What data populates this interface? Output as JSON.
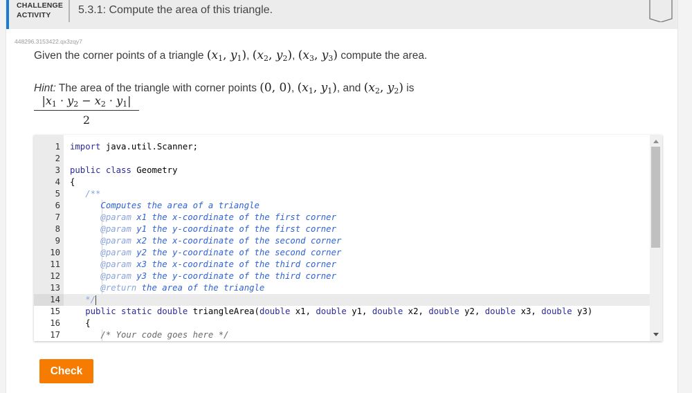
{
  "header": {
    "kind_line1": "CHALLENGE",
    "kind_line2": "ACTIVITY",
    "title": "5.3.1: Compute the area of this triangle.",
    "accent_color": "#1b7cd1",
    "bookmark_icon": "bookmark-icon"
  },
  "activity_id": "448296.3153422.qx3zqy7",
  "prompt": {
    "prefix": "Given the corner points of a triangle ",
    "points": [
      "(x1, y1)",
      "(x2, y2)",
      "(x3, y3)"
    ],
    "suffix": " compute the area."
  },
  "hint": {
    "label": "Hint:",
    "text_before": " The area of the triangle with corner points ",
    "points": [
      "(0, 0)",
      "(x1, y1)",
      "(x2, y2)"
    ],
    "and": " and ",
    "is": " is",
    "formula_numerator": "|x1 · y2 − x2 · y1|",
    "formula_denominator": "2"
  },
  "editor": {
    "language": "java",
    "active_line": 14,
    "lines": [
      {
        "n": "1",
        "text": "import java.util.Scanner;"
      },
      {
        "n": "2",
        "text": ""
      },
      {
        "n": "3",
        "text": "public class Geometry"
      },
      {
        "n": "4",
        "text": "{"
      },
      {
        "n": "5",
        "text": "   /**"
      },
      {
        "n": "6",
        "text": "      Computes the area of a triangle"
      },
      {
        "n": "7",
        "text": "      @param x1 the x-coordinate of the first corner"
      },
      {
        "n": "8",
        "text": "      @param y1 the y-coordinate of the first corner"
      },
      {
        "n": "9",
        "text": "      @param x2 the x-coordinate of the second corner"
      },
      {
        "n": "10",
        "text": "      @param y2 the y-coordinate of the second corner"
      },
      {
        "n": "11",
        "text": "      @param x3 the x-coordinate of the third corner"
      },
      {
        "n": "12",
        "text": "      @param y3 the y-coordinate of the third corner"
      },
      {
        "n": "13",
        "text": "      @return the area of the triangle"
      },
      {
        "n": "14",
        "text": "   */"
      },
      {
        "n": "15",
        "text": "   public static double triangleArea(double x1, double y1, double x2, double y2, double x3, double y3)"
      },
      {
        "n": "16",
        "text": "   {"
      },
      {
        "n": "17",
        "text": "      /* Your code goes here */"
      }
    ],
    "scroll_position_fraction": 0.0
  },
  "check_button": {
    "label": "Check",
    "color": "#f57c00"
  }
}
